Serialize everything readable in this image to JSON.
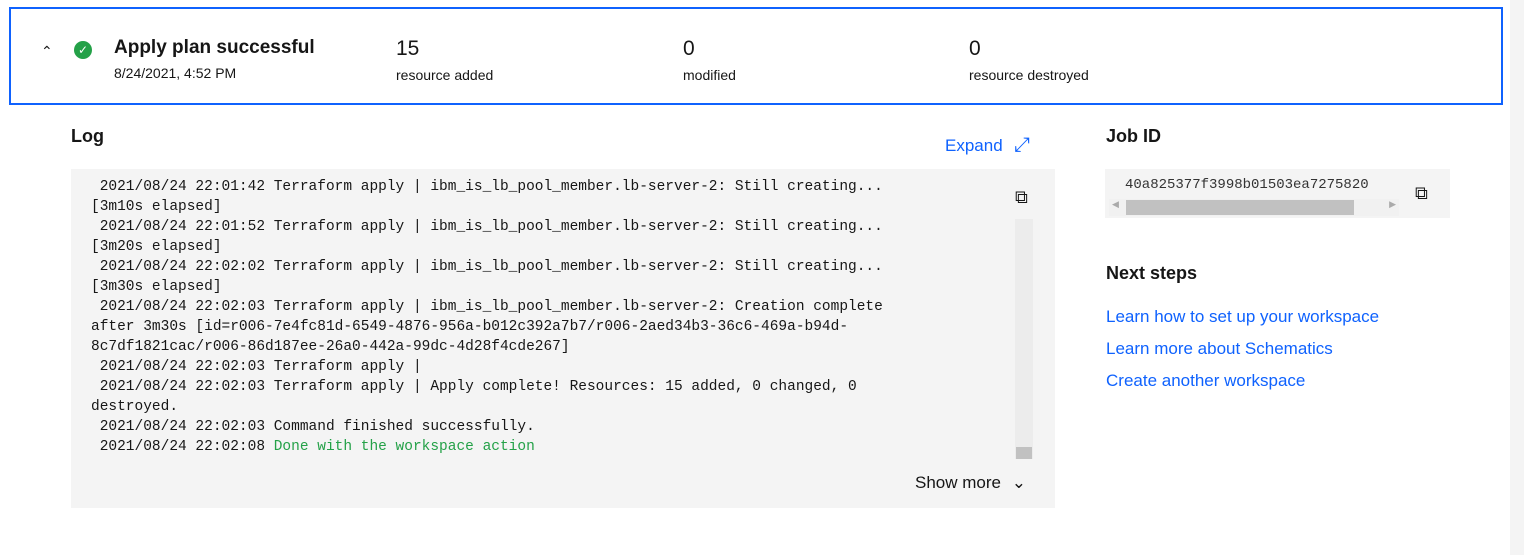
{
  "summary": {
    "title": "Apply plan successful",
    "date": "8/24/2021, 4:52 PM",
    "stats": [
      {
        "value": "15",
        "label": "resource added"
      },
      {
        "value": "0",
        "label": "modified"
      },
      {
        "value": "0",
        "label": "resource destroyed"
      }
    ]
  },
  "log": {
    "heading": "Log",
    "expand_label": "Expand",
    "show_more": "Show more",
    "lines": [
      " 2021/08/24 22:01:42 Terraform apply | ibm_is_lb_pool_member.lb-server-2: Still creating...\n[3m10s elapsed]",
      " 2021/08/24 22:01:52 Terraform apply | ibm_is_lb_pool_member.lb-server-2: Still creating...\n[3m20s elapsed]",
      " 2021/08/24 22:02:02 Terraform apply | ibm_is_lb_pool_member.lb-server-2: Still creating...\n[3m30s elapsed]",
      " 2021/08/24 22:02:03 Terraform apply | ibm_is_lb_pool_member.lb-server-2: Creation complete\nafter 3m30s [id=r006-7e4fc81d-6549-4876-956a-b012c392a7b7/r006-2aed34b3-36c6-469a-b94d-\n8c7df1821cac/r006-86d187ee-26a0-442a-99dc-4d28f4cde267]",
      " 2021/08/24 22:02:03 Terraform apply |",
      " 2021/08/24 22:02:03 Terraform apply | Apply complete! Resources: 15 added, 0 changed, 0\ndestroyed.",
      " 2021/08/24 22:02:03 Command finished successfully."
    ],
    "last_prefix": " 2021/08/24 22:02:08 ",
    "last_message": "Done with the workspace action"
  },
  "job": {
    "heading": "Job ID",
    "id": "40a825377f3998b01503ea7275820"
  },
  "next_steps": {
    "heading": "Next steps",
    "links": [
      "Learn how to set up your workspace",
      "Learn more about Schematics",
      "Create another workspace"
    ]
  }
}
